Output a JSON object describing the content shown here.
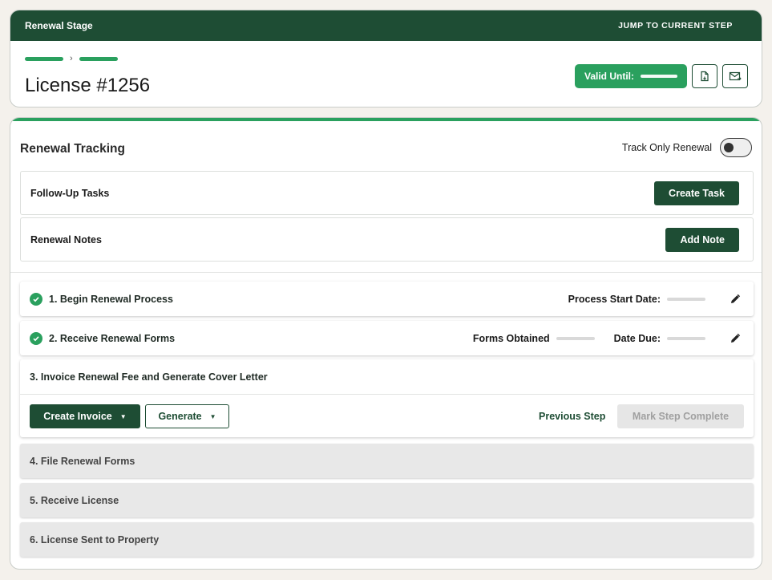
{
  "header": {
    "stage_title": "Renewal Stage",
    "jump_link": "JUMP TO CURRENT STEP",
    "breadcrumb_separator": "›",
    "title": "License #1256",
    "valid_until_label": "Valid Until:",
    "icons": [
      "document-export-icon",
      "mail-send-icon"
    ]
  },
  "tracking": {
    "title": "Renewal Tracking",
    "toggle_label": "Track Only Renewal",
    "toggle_on": false
  },
  "panels": {
    "followup_title": "Follow-Up Tasks",
    "followup_button": "Create Task",
    "notes_title": "Renewal Notes",
    "notes_button": "Add Note"
  },
  "steps": [
    {
      "label": "1.  Begin Renewal Process",
      "status": "complete",
      "meta": [
        "Process Start Date:"
      ]
    },
    {
      "label": "2.  Receive Renewal Forms",
      "status": "complete",
      "meta": [
        "Forms Obtained",
        "Date Due:"
      ]
    },
    {
      "label": "3.  Invoice Renewal Fee and Generate Cover Letter",
      "status": "current",
      "actions": {
        "invoice": "Create Invoice",
        "generate": "Generate",
        "previous": "Previous Step",
        "complete": "Mark Step Complete"
      }
    },
    {
      "label": "4.  File Renewal Forms",
      "status": "pending"
    },
    {
      "label": "5.  Receive License",
      "status": "pending"
    },
    {
      "label": "6.  License Sent to Property",
      "status": "pending"
    }
  ],
  "colors": {
    "brand_dark": "#1e4d34",
    "accent_green": "#2aa05e",
    "pending_bg": "#e8e8e8"
  }
}
